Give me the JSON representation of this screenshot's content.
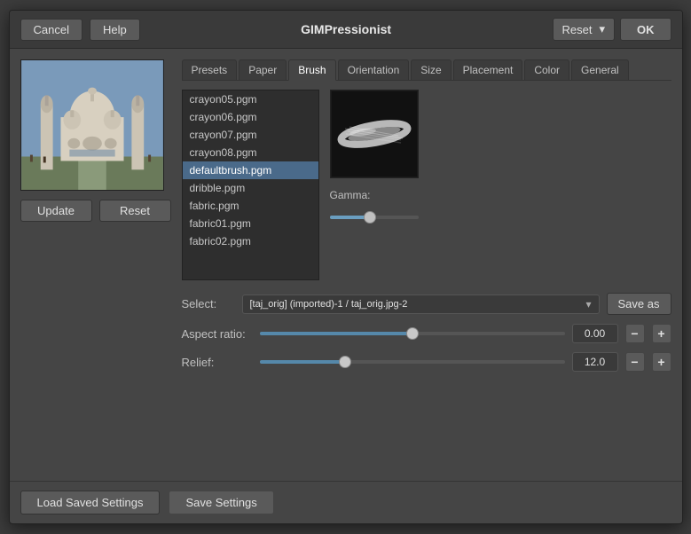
{
  "titlebar": {
    "cancel_label": "Cancel",
    "help_label": "Help",
    "title": "GIMPressionist",
    "reset_label": "Reset",
    "ok_label": "OK"
  },
  "tabs": [
    {
      "id": "presets",
      "label": "Presets"
    },
    {
      "id": "paper",
      "label": "Paper"
    },
    {
      "id": "brush",
      "label": "Brush"
    },
    {
      "id": "orientation",
      "label": "Orientation"
    },
    {
      "id": "size",
      "label": "Size"
    },
    {
      "id": "placement",
      "label": "Placement"
    },
    {
      "id": "color",
      "label": "Color"
    },
    {
      "id": "general",
      "label": "General"
    }
  ],
  "active_tab": "brush",
  "brush_list": [
    {
      "name": "crayon05.pgm"
    },
    {
      "name": "crayon06.pgm"
    },
    {
      "name": "crayon07.pgm"
    },
    {
      "name": "crayon08.pgm"
    },
    {
      "name": "defaultbrush.pgm",
      "selected": true
    },
    {
      "name": "dribble.pgm"
    },
    {
      "name": "fabric.pgm"
    },
    {
      "name": "fabric01.pgm"
    },
    {
      "name": "fabric02.pgm"
    }
  ],
  "gamma": {
    "label": "Gamma:",
    "value": 45
  },
  "select": {
    "label": "Select:",
    "value": "[taj_orig] (imported)-1 / taj_orig.jpg-2",
    "save_as_label": "Save as"
  },
  "aspect_ratio": {
    "label": "Aspect ratio:",
    "value": "0.00",
    "slider_percent": 50
  },
  "relief": {
    "label": "Relief:",
    "value": "12.0",
    "slider_percent": 28
  },
  "bottom": {
    "load_label": "Load Saved Settings",
    "save_label": "Save Settings"
  },
  "left_buttons": {
    "update_label": "Update",
    "reset_label": "Reset"
  }
}
